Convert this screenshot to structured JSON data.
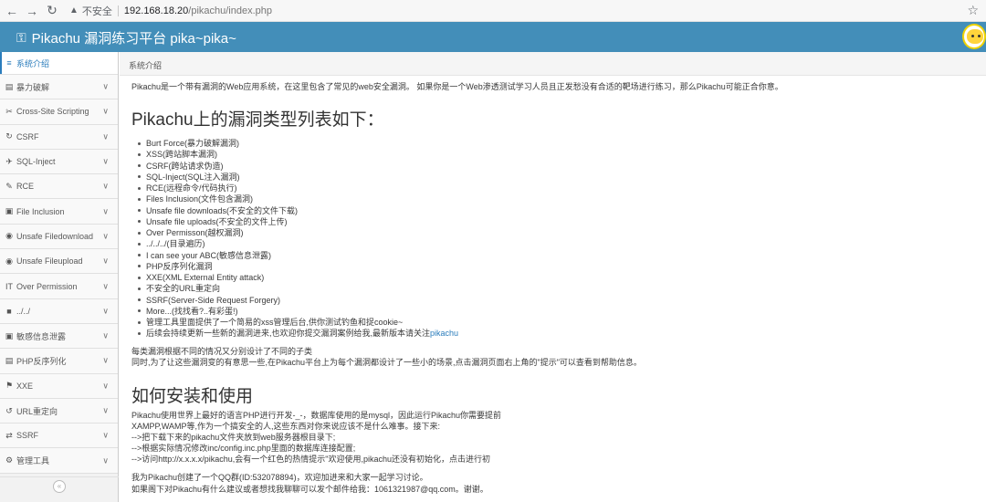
{
  "browser": {
    "insecure_label": "不安全",
    "host": "192.168.18.20",
    "path": "/pikachu/index.php"
  },
  "navbar": {
    "brand": "Pikachu 漏洞练习平台 pika~pika~"
  },
  "sidebar": {
    "items": [
      {
        "label": "系统介绍",
        "icon": "book-icon",
        "glyph": "≡"
      },
      {
        "label": "暴力破解",
        "icon": "list-icon",
        "glyph": "▤"
      },
      {
        "label": "Cross-Site Scripting",
        "icon": "code-icon",
        "glyph": "✂"
      },
      {
        "label": "CSRF",
        "icon": "refresh-icon",
        "glyph": "↻"
      },
      {
        "label": "SQL-Inject",
        "icon": "plane-icon",
        "glyph": "✈"
      },
      {
        "label": "RCE",
        "icon": "pencil-icon",
        "glyph": "✎"
      },
      {
        "label": "File Inclusion",
        "icon": "file-icon",
        "glyph": "▣"
      },
      {
        "label": "Unsafe Filedownload",
        "icon": "download-icon",
        "glyph": "◉"
      },
      {
        "label": "Unsafe Fileupload",
        "icon": "upload-icon",
        "glyph": "◉"
      },
      {
        "label": "Over Permission",
        "icon": "text-icon",
        "glyph": "IT"
      },
      {
        "label": "../../",
        "icon": "folder-icon",
        "glyph": "■"
      },
      {
        "label": "敏感信息泄露",
        "icon": "lock-icon",
        "glyph": "▣"
      },
      {
        "label": "PHP反序列化",
        "icon": "archive-icon",
        "glyph": "▤"
      },
      {
        "label": "XXE",
        "icon": "flag-icon",
        "glyph": "⚑"
      },
      {
        "label": "URL重定向",
        "icon": "redirect-icon",
        "glyph": "↺"
      },
      {
        "label": "SSRF",
        "icon": "exchange-icon",
        "glyph": "⇄"
      },
      {
        "label": "管理工具",
        "icon": "gear-icon",
        "glyph": "⚙"
      }
    ],
    "chevron": "∨",
    "collapse_glyph": "«"
  },
  "breadcrumb": "系统介绍",
  "main": {
    "intro": "Pikachu是一个带有漏洞的Web应用系统，在这里包含了常见的web安全漏洞。 如果你是一个Web渗透测试学习人员且正发愁没有合适的靶场进行练习，那么Pikachu可能正合你意。",
    "list_title": "Pikachu上的漏洞类型列表如下：",
    "vulns": [
      "Burt Force(暴力破解漏洞)",
      "XSS(跨站脚本漏洞)",
      "CSRF(跨站请求伪造)",
      "SQL-Inject(SQL注入漏洞)",
      "RCE(远程命令/代码执行)",
      "Files Inclusion(文件包含漏洞)",
      "Unsafe file downloads(不安全的文件下载)",
      "Unsafe file uploads(不安全的文件上传)",
      "Over Permisson(越权漏洞)",
      "../../../(目录遍历)",
      "I can see your ABC(敏感信息泄露)",
      "PHP反序列化漏洞",
      "XXE(XML External Entity attack)",
      "不安全的URL重定向",
      "SSRF(Server-Side Request Forgery)",
      "More...(找找看?..有彩蛋!)",
      "管理工具里面提供了一个简易的xss管理后台,供你测试钓鱼和捉cookie~"
    ],
    "last_item_text": "后续会持续更新一些新的漏洞进来,也欢迎你提交漏洞案例给我,最新版本请关注",
    "last_item_link": "pikachu",
    "note_1": "每类漏洞根据不同的情况又分别设计了不同的子类",
    "note_2": "同时,为了让这些漏洞变的有意思一些,在Pikachu平台上为每个漏洞都设计了一些小的场景,点击漏洞页面右上角的\"提示\"可以查看到帮助信息。",
    "install_title": "如何安装和使用",
    "install_lines": [
      "Pikachu使用世界上最好的语言PHP进行开发-_-，数据库使用的是mysql，因此运行Pikachu你需要提前",
      "XAMPP,WAMP等,作为一个搞安全的人,这些东西对你来说应该不是什么难事。接下来:",
      "-->把下载下来的pikachu文件夹放到web服务器根目录下;",
      "-->根据实际情况修改inc/config.inc.php里面的数据库连接配置;",
      "-->访问http://x.x.x.x/pikachu,会有一个红色的热情提示\"欢迎使用,pikachu还没有初始化，点击进行初"
    ],
    "contact_1": "我为Pikachu创建了一个QQ群(ID:532078894)，欢迎加进来和大家一起学习讨论。",
    "contact_2": "如果阁下对Pikachu有什么建议或者想找我聊聊可以发个邮件给我：1061321987@qq.com。谢谢。"
  }
}
